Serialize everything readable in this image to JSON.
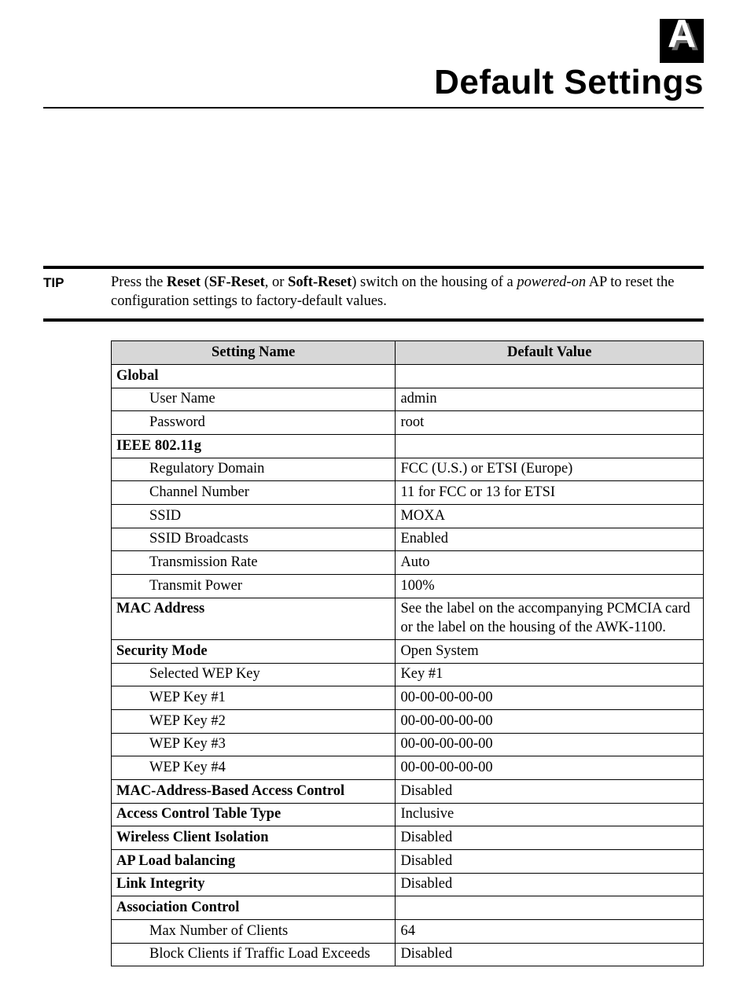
{
  "appendix_letter": "A",
  "page_title": "Default Settings",
  "tip": {
    "label": "TIP",
    "text_pre": "Press the ",
    "reset_b": "Reset",
    "text_paren_open": " (",
    "sf_b": "SF-Reset",
    "text_or": ", or ",
    "soft_b": "Soft-Reset",
    "text_paren_close": ") switch on the housing of a ",
    "powered_i": "powered-on",
    "text_tail": " AP to reset the configuration settings to factory-default values."
  },
  "headers": {
    "col1": "Setting Name",
    "col2": "Default Value"
  },
  "rows": [
    {
      "section": true,
      "name": "Global",
      "value": ""
    },
    {
      "section": false,
      "name": "User Name",
      "value": "admin"
    },
    {
      "section": false,
      "name": "Password",
      "value": "root"
    },
    {
      "section": true,
      "name": "IEEE 802.11g",
      "value": ""
    },
    {
      "section": false,
      "name": "Regulatory Domain",
      "value": "FCC (U.S.) or ETSI (Europe)"
    },
    {
      "section": false,
      "name": "Channel Number",
      "value": "11 for FCC or 13 for ETSI"
    },
    {
      "section": false,
      "name": "SSID",
      "value": "MOXA"
    },
    {
      "section": false,
      "name": "SSID Broadcasts",
      "value": "Enabled"
    },
    {
      "section": false,
      "name": "Transmission Rate",
      "value": "Auto"
    },
    {
      "section": false,
      "name": "Transmit Power",
      "value": "100%"
    },
    {
      "section": true,
      "name": "MAC Address",
      "value": "See the label on the accompanying PCMCIA card or the label on the housing of the AWK-1100."
    },
    {
      "section": true,
      "name": "Security Mode",
      "value": "Open System"
    },
    {
      "section": false,
      "name": "Selected WEP Key",
      "value": "Key #1"
    },
    {
      "section": false,
      "name": "WEP Key #1",
      "value": "00-00-00-00-00"
    },
    {
      "section": false,
      "name": "WEP Key #2",
      "value": "00-00-00-00-00"
    },
    {
      "section": false,
      "name": "WEP Key #3",
      "value": "00-00-00-00-00"
    },
    {
      "section": false,
      "name": "WEP Key #4",
      "value": "00-00-00-00-00"
    },
    {
      "section": true,
      "name": "MAC-Address-Based Access Control",
      "value": "Disabled"
    },
    {
      "section": true,
      "name": "Access Control Table Type",
      "value": "Inclusive"
    },
    {
      "section": true,
      "name": "Wireless Client Isolation",
      "value": "Disabled"
    },
    {
      "section": true,
      "name": "AP Load balancing",
      "value": "Disabled"
    },
    {
      "section": true,
      "name": "Link Integrity",
      "value": "Disabled"
    },
    {
      "section": true,
      "name": "Association Control",
      "value": ""
    },
    {
      "section": false,
      "name": "Max Number of Clients",
      "value": "64"
    },
    {
      "section": false,
      "name": "Block Clients if Traffic Load Exceeds",
      "value": "Disabled"
    }
  ]
}
